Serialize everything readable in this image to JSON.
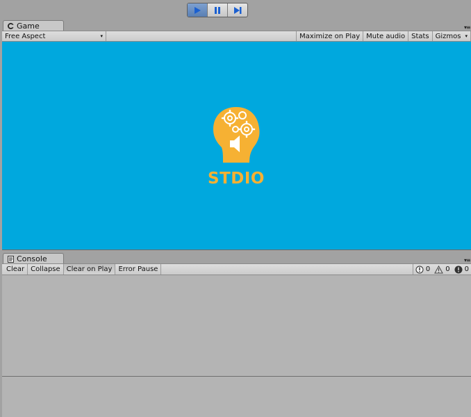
{
  "toolbar": {
    "play_icon": "play-icon",
    "pause_icon": "pause-icon",
    "step_icon": "step-icon"
  },
  "game": {
    "tab_label": "Game",
    "aspect": "Free Aspect",
    "buttons": [
      "Maximize on Play",
      "Mute audio",
      "Stats",
      "Gizmos"
    ],
    "background_color": "#00a8de",
    "logo_text": "STDIO",
    "logo_color": "#f6b133"
  },
  "console": {
    "tab_label": "Console",
    "buttons": [
      "Clear",
      "Collapse",
      "Clear on Play",
      "Error Pause"
    ],
    "counts": {
      "info": "0",
      "warning": "0",
      "error": "0"
    }
  }
}
